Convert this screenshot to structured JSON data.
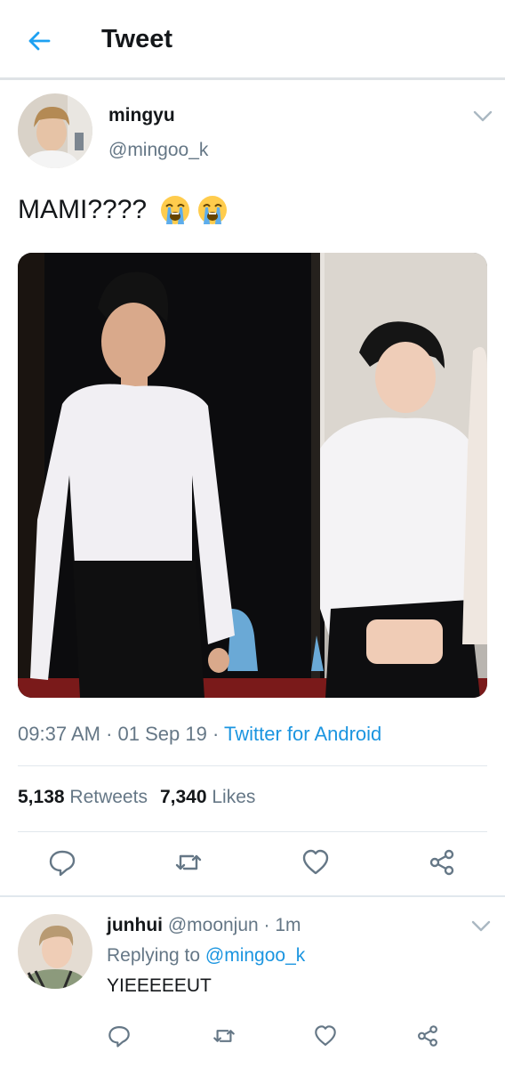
{
  "header": {
    "title": "Tweet"
  },
  "tweet": {
    "name": "mingyu",
    "handle": "@mingoo_k",
    "text": "MAMI????",
    "emojis": [
      "loudly-crying-face",
      "loudly-crying-face"
    ],
    "time": "09:37 AM",
    "date": "01 Sep 19",
    "source": "Twitter for Android",
    "retweet_count": "5,138",
    "retweet_label": "Retweets",
    "like_count": "7,340",
    "like_label": "Likes"
  },
  "reply": {
    "name": "junhui",
    "handle": "@moonjun",
    "time": "1m",
    "replying_prefix": "Replying to",
    "replying_to": "@mingoo_k",
    "text": "YIEEEEEUT"
  },
  "colors": {
    "link": "#1b95e0",
    "secondary_text": "#657786",
    "icon": "#657786"
  }
}
